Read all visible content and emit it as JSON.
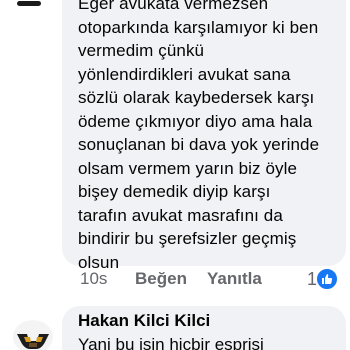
{
  "comment": {
    "text": "Eğer avukata vermezsen\notoparkında karşılamıyor ki ben\nvermedim çünkü\nyönlendirdikleri avukat sana\nsözlü olarak kaybedersek karşı\nödeme çıkmıyor diyo ama hala\nsonuçlanan bi dava yok yerinde\nolsam vermem yarın biz öyle\nbişey demedik diyip karşı\ntarafın avukat masrafını da\nbindirir bu şerefsizler geçmiş\nolsun",
    "time": "10s",
    "like_label": "Beğen",
    "reply_label": "Yanıtla",
    "reaction_count": "1",
    "reaction_icon": "like-icon",
    "reaction_color": "#1877f2"
  },
  "reply": {
    "author": "Hakan Kilci Kilci",
    "text": "Yani bu işin hiçbir esprisi"
  },
  "colors": {
    "bubble": "#f0f2f5",
    "text": "#050505",
    "muted": "#65676b"
  }
}
